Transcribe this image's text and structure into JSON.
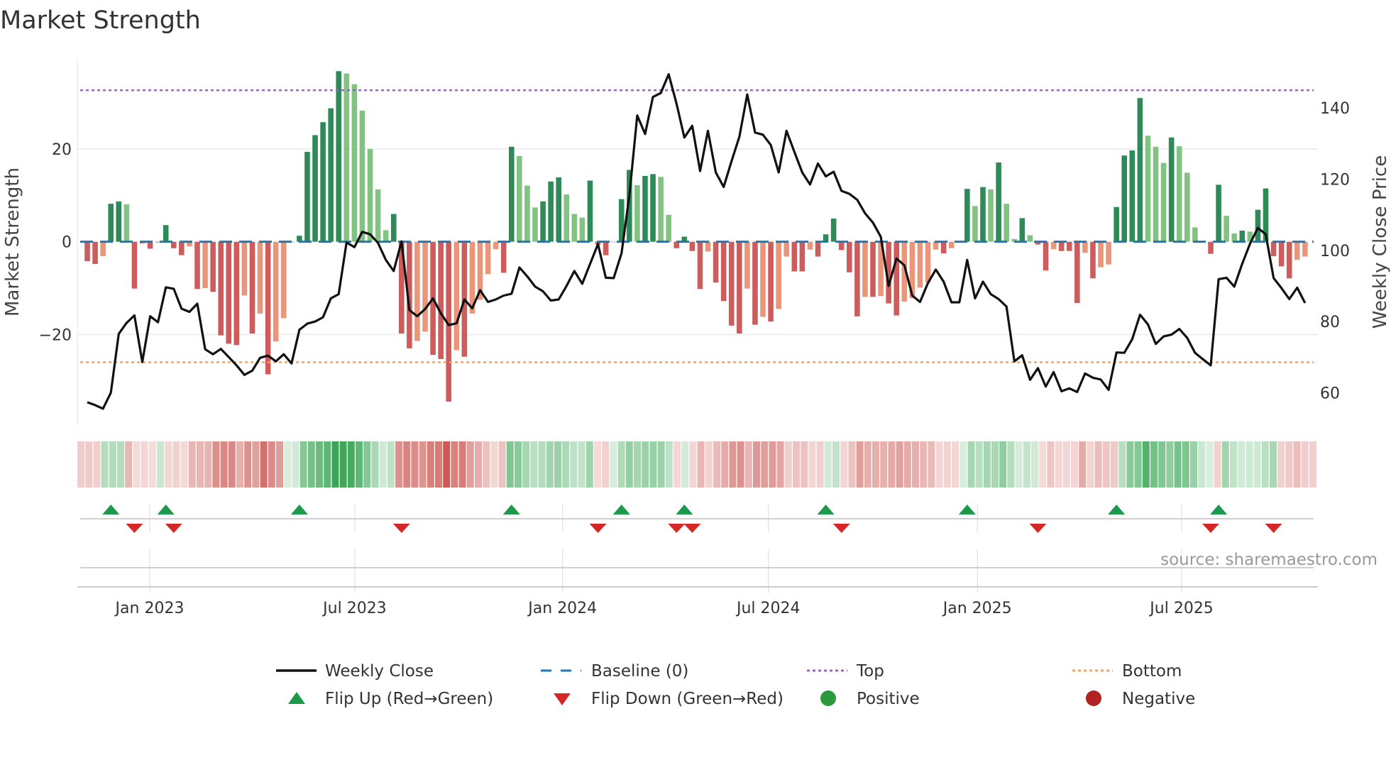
{
  "chart_data": {
    "type": "bar",
    "title": "Market Strength",
    "ylabel": "Market Strength",
    "ylabel_right": "Weekly Close Price",
    "ylim": [
      -39.7,
      39.6
    ],
    "ylim_right": [
      50.7,
      154
    ],
    "x_unit": "week index",
    "x_ticks": [
      {
        "label": "Jan 2023",
        "week": 7.95
      },
      {
        "label": "Jul 2023",
        "week": 34.05
      },
      {
        "label": "Jan 2024",
        "week": 60.5
      },
      {
        "label": "Jul 2024",
        "week": 86.7
      },
      {
        "label": "Jan 2025",
        "week": 113.3
      },
      {
        "label": "Jul 2025",
        "week": 139.3
      }
    ],
    "left_ticks": [
      {
        "label": "20",
        "value": 20
      },
      {
        "label": "0",
        "value": 0
      },
      {
        "label": "−20",
        "value": -20
      }
    ],
    "right_ticks": [
      {
        "label": "60",
        "value": 60
      },
      {
        "label": "80",
        "value": 80
      },
      {
        "label": "100",
        "value": 100
      },
      {
        "label": "120",
        "value": 120
      },
      {
        "label": "140",
        "value": 140
      }
    ],
    "levels": {
      "top": 32.7,
      "bottom": -26,
      "baseline": 0
    },
    "strength": [
      -4.2,
      -4.8,
      -3.1,
      8.2,
      8.7,
      8.1,
      -10.1,
      -0.4,
      -1.5,
      -0.2,
      3.6,
      -1.4,
      -2.9,
      -1,
      -10.2,
      -10,
      -10.8,
      -20.2,
      -22,
      -22.3,
      -11.6,
      -19.8,
      -15.5,
      -28.6,
      -21.5,
      -16.5,
      0,
      1.3,
      19.4,
      23,
      25.8,
      28.8,
      36.8,
      36.3,
      34,
      28.3,
      20,
      11.3,
      2.5,
      6,
      -19.8,
      -23,
      -21.4,
      -19.4,
      -24.4,
      -25.3,
      -34.5,
      -23.4,
      -24.8,
      -15.5,
      -12.5,
      -7,
      -1.6,
      -6.7,
      20.5,
      18.5,
      12.1,
      7.4,
      8.7,
      13,
      13.9,
      10.2,
      6,
      5.2,
      13.2,
      -0.6,
      -2.9,
      0,
      9.2,
      15.5,
      12.2,
      14.2,
      14.6,
      14,
      5.8,
      -1.4,
      1.1,
      -2,
      -10.2,
      -2.1,
      -8.8,
      -12.8,
      -18.1,
      -19.8,
      -10.1,
      -17.9,
      -16.2,
      -17.2,
      -14.5,
      -3.2,
      -6.4,
      -6.4,
      -1.7,
      -3.2,
      1.6,
      5,
      -1.8,
      -6.6,
      -16.1,
      -11.9,
      -11.9,
      -11.7,
      -13.3,
      -15.9,
      -12.9,
      -12.2,
      -9.9,
      -8.8,
      -1.7,
      -2.5,
      -1.4,
      0,
      11.4,
      7.7,
      11.8,
      11.3,
      17.1,
      8.2,
      0.6,
      5.1,
      1.4,
      -0.6,
      -6.2,
      -1.6,
      -2,
      -2,
      -13.2,
      -2.4,
      -7.9,
      -5.5,
      -4.9,
      7.5,
      18.6,
      19.7,
      31,
      22.9,
      20.5,
      17,
      22.5,
      20.6,
      14.9,
      3.1,
      0.2,
      -2.6,
      12.3,
      5.6,
      1.8,
      2.4,
      2.2,
      6.9,
      11.5,
      -3.1,
      -5.3,
      -7.9,
      -3.9,
      -3.2
    ],
    "close": [
      57.3,
      56.5,
      55.5,
      60,
      76.5,
      79.6,
      81.7,
      68.6,
      81.5,
      79.8,
      89.6,
      89.2,
      83.6,
      82.7,
      85,
      72.2,
      70.8,
      72.3,
      70,
      67.7,
      65,
      66.2,
      69.8,
      70.4,
      68.8,
      70.8,
      68.2,
      77.7,
      79.4,
      80,
      81.2,
      86.5,
      87.7,
      102.2,
      100.9,
      105.2,
      104.5,
      102.1,
      97.3,
      94.2,
      102.5,
      83.2,
      81.5,
      83.5,
      86.5,
      82.3,
      79,
      79.5,
      86.2,
      83.7,
      88.8,
      85.5,
      86.2,
      87.3,
      87.8,
      95.2,
      92.7,
      89.8,
      88.5,
      85.9,
      86.2,
      90,
      94.2,
      90.6,
      96.2,
      101.8,
      92.3,
      92.2,
      99.2,
      115.4,
      137.9,
      132.7,
      143.1,
      144.2,
      149.5,
      141.2,
      131.7,
      135,
      122.3,
      133.6,
      121.9,
      117.8,
      125,
      131.9,
      143.8,
      133.1,
      132.5,
      129.6,
      121.9,
      133.6,
      127.7,
      121.9,
      118.5,
      124.4,
      120.8,
      122.1,
      116.7,
      115.9,
      114.2,
      110.4,
      107.8,
      103.8,
      90,
      97.7,
      95.8,
      87.3,
      85.5,
      90.8,
      94.6,
      91.2,
      85.4,
      85.4,
      97.3,
      86.5,
      91.2,
      87.7,
      86.3,
      84.2,
      68.8,
      70.5,
      63.6,
      66.9,
      61.7,
      65.8,
      60.4,
      61.2,
      60.2,
      65.4,
      64.2,
      63.7,
      60.8,
      71.3,
      71.2,
      75,
      81.9,
      79.2,
      73.7,
      75.8,
      76.3,
      77.9,
      75.4,
      71.2,
      69.4,
      67.7,
      91.9,
      92.3,
      89.8,
      96.2,
      101.9,
      106.3,
      104.5,
      92.2,
      89.4,
      86.3,
      89.5,
      85.2
    ],
    "flip_up": [
      3,
      10,
      27,
      54,
      68,
      76,
      94,
      112,
      131,
      144
    ],
    "flip_down": [
      6,
      11,
      40,
      65,
      75,
      77,
      96,
      121,
      143,
      151
    ],
    "legend": {
      "placement": "bottom",
      "weekly_close": "Weekly Close",
      "baseline": "Baseline (0)",
      "top": "Top",
      "bottom": "Bottom",
      "flip_up": "Flip Up (Red→Green)",
      "flip_down": "Flip Down (Green→Red)",
      "positive": "Positive",
      "negative": "Negative"
    },
    "source": "source: sharemaestro.com",
    "colors": {
      "pos_strong": "#2e8b57",
      "pos_weak": "#82c282",
      "neg_strong": "#cd5c5c",
      "neg_weak": "#e9967a",
      "line": "#111111",
      "baseline": "#1f77b4",
      "top": "#9467bd",
      "bottom": "#f4a460",
      "flip_up": "#1a9a4a",
      "flip_down": "#d62728",
      "positive": "#2a9a3a",
      "negative": "#b22222",
      "heat_pos": "#3aa655",
      "heat_neg": "#c9504a"
    }
  }
}
